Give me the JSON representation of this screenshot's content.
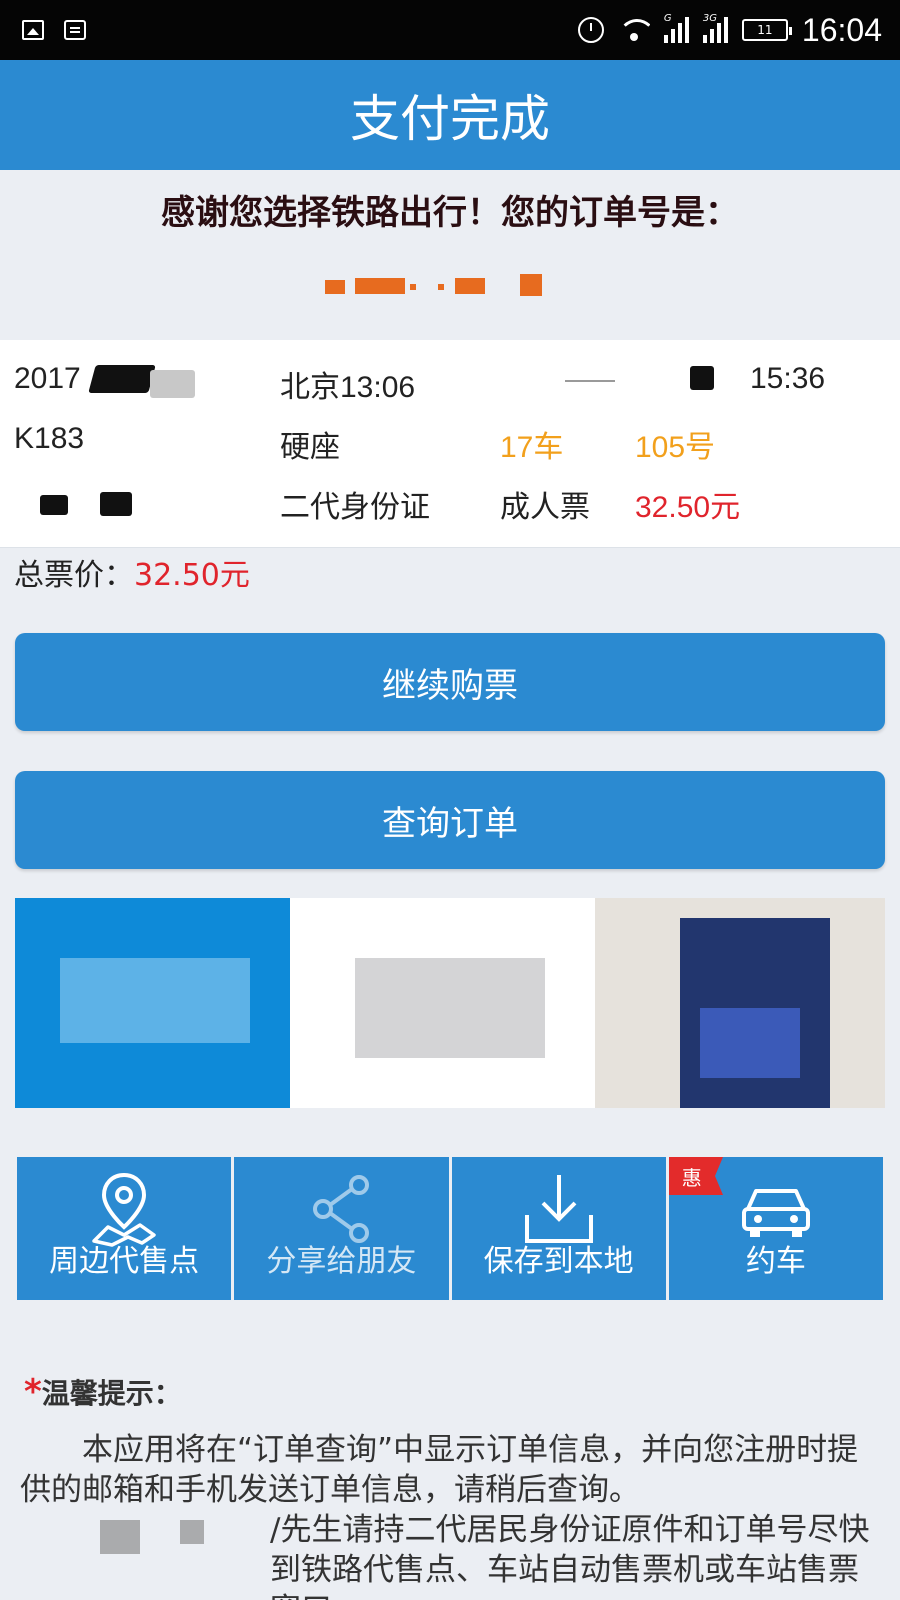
{
  "status_bar": {
    "time": "16:04",
    "battery": "11",
    "signal1_tag": "G",
    "signal2_tag": "3G"
  },
  "header": {
    "title": "支付完成"
  },
  "thanks": {
    "text": "感谢您选择铁路出行！您的订单号是："
  },
  "ticket": {
    "date": "2017",
    "from_station_time": "北京13:06",
    "arrive_time": "15:36",
    "train_no": "K183",
    "seat_type": "硬座",
    "car": "17车",
    "seat": "105号",
    "id_type": "二代身份证",
    "ticket_type": "成人票",
    "price": "32.50元"
  },
  "total": {
    "label": "总票价：",
    "value": "32.50元"
  },
  "buttons": {
    "continue": "继续购票",
    "query": "查询订单"
  },
  "tiles": [
    {
      "label": "周边代售点",
      "icon": "map-pin-icon"
    },
    {
      "label": "分享给朋友",
      "icon": "share-icon"
    },
    {
      "label": "保存到本地",
      "icon": "download-icon"
    },
    {
      "label": "约车",
      "icon": "car-icon",
      "badge": "惠"
    }
  ],
  "tips": {
    "star": "*",
    "title": "温馨提示：",
    "para1": "本应用将在“订单查询”中显示订单信息，并向您注册时提供的邮箱和手机发送订单信息，请稍后查询。",
    "para2": "/先生请持二代居民身份证原件和订单号尽快到铁路代售点、车站自动售票机或车站售票窗口"
  },
  "colors": {
    "primary": "#2b8ad1",
    "accent_orange": "#f2a01c",
    "accent_red": "#e0242c",
    "background": "#ebeef3"
  }
}
